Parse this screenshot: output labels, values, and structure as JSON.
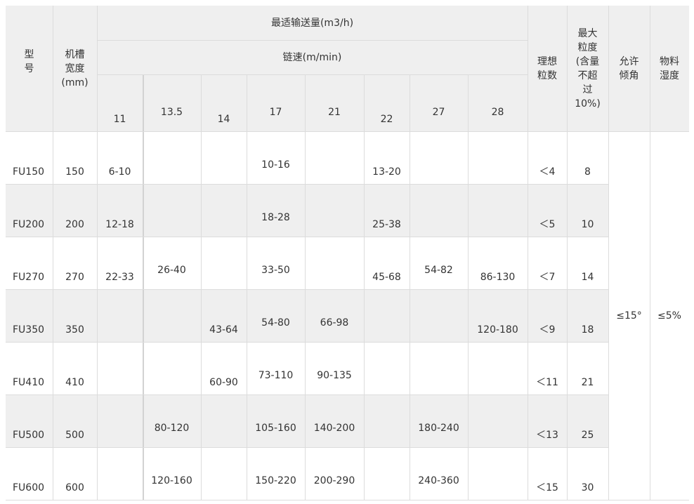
{
  "header": {
    "model": "型\n号",
    "width": "机槽\n宽度\n(mm)",
    "capacity": "最适输送量(m3/h)",
    "chain_speed": "链速(m/min)",
    "speeds": [
      "11",
      "13.5",
      "14",
      "17",
      "21",
      "22",
      "27",
      "28"
    ],
    "ideal_particles": "理想\n粒数",
    "max_size": "最大\n粒度\n(含量\n不超\n过\n10%)",
    "angle": "允许\n倾角",
    "moisture": "物料\n湿度"
  },
  "rows": [
    {
      "model": "FU150",
      "width": "150",
      "s11": "6-10",
      "s135": "",
      "s14": "",
      "s17": "10-16",
      "s21": "",
      "s22": "13-20",
      "s27": "",
      "s28": "",
      "ideal": "＜4",
      "max": "8"
    },
    {
      "model": "FU200",
      "width": "200",
      "s11": "12-18",
      "s135": "",
      "s14": "",
      "s17": "18-28",
      "s21": "",
      "s22": "25-38",
      "s27": "",
      "s28": "",
      "ideal": "＜5",
      "max": "10"
    },
    {
      "model": "FU270",
      "width": "270",
      "s11": "22-33",
      "s135": "26-40",
      "s14": "",
      "s17": "33-50",
      "s21": "",
      "s22": "45-68",
      "s27": "54-82",
      "s28": "86-130",
      "ideal": "＜7",
      "max": "14"
    },
    {
      "model": "FU350",
      "width": "350",
      "s11": "",
      "s135": "",
      "s14": "43-64",
      "s17": "54-80",
      "s21": "66-98",
      "s22": "",
      "s27": "",
      "s28": "120-180",
      "ideal": "＜9",
      "max": "18"
    },
    {
      "model": "FU410",
      "width": "410",
      "s11": "",
      "s135": "",
      "s14": "60-90",
      "s17": "73-110",
      "s21": "90-135",
      "s22": "",
      "s27": "",
      "s28": "",
      "ideal": "＜11",
      "max": "21"
    },
    {
      "model": "FU500",
      "width": "500",
      "s11": "",
      "s135": "80-120",
      "s14": "",
      "s17": "105-160",
      "s21": "140-200",
      "s22": "",
      "s27": "180-240",
      "s28": "",
      "ideal": "＜13",
      "max": "25"
    },
    {
      "model": "FU600",
      "width": "600",
      "s11": "",
      "s135": "120-160",
      "s14": "",
      "s17": "150-220",
      "s21": "200-290",
      "s22": "",
      "s27": "240-360",
      "s28": "",
      "ideal": "＜15",
      "max": "30"
    }
  ],
  "shared": {
    "angle": "≤15°",
    "moisture": "≤5%"
  }
}
